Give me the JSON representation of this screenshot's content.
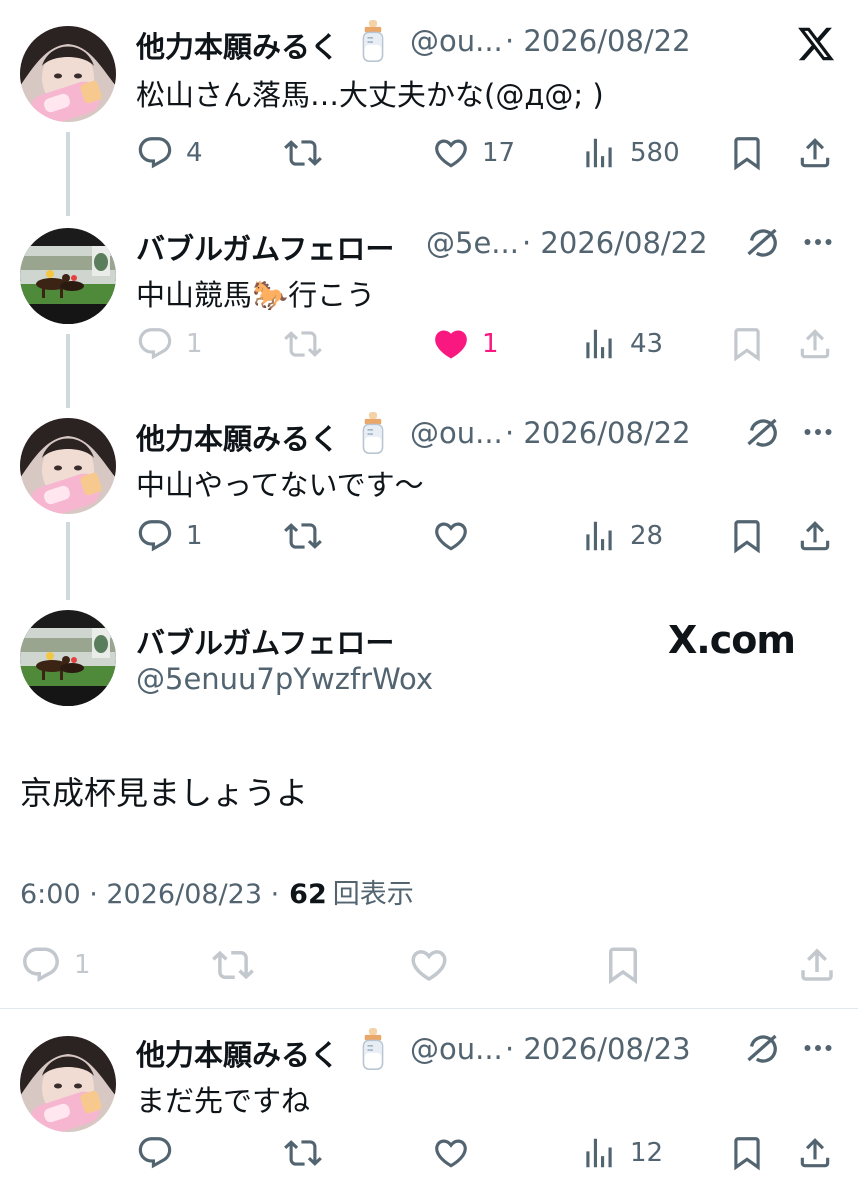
{
  "colors": {
    "text": "#0f1419",
    "muted": "#536471",
    "like_active": "#f91880",
    "line": "#cfd9de"
  },
  "tweets": [
    {
      "name": "他力本願みるく",
      "emoji_icon": "baby-bottle-icon",
      "handle": "@ou...",
      "date": "· 2026/08/22",
      "text": "松山さん落馬…大丈夫かな(@д@; )",
      "replies": "4",
      "retweets": "",
      "likes": "17",
      "views": "580"
    },
    {
      "name": "バブルガムフェロー",
      "handle": "@5e...",
      "date": "· 2026/08/22",
      "text": "中山競馬🐎行こう",
      "replies": "1",
      "retweets": "",
      "likes": "1",
      "views": "43"
    },
    {
      "name": "他力本願みるく",
      "emoji_icon": "baby-bottle-icon",
      "handle": "@ou...",
      "date": "· 2026/08/22",
      "text": "中山やってないです〜",
      "replies": "1",
      "retweets": "",
      "likes": "",
      "views": "28"
    },
    {
      "name": "他力本願みるく",
      "emoji_icon": "baby-bottle-icon",
      "handle": "@ou...",
      "date": "· 2026/08/23",
      "text": "まだ先ですね",
      "replies": "",
      "retweets": "",
      "likes": "",
      "views": "12"
    }
  ],
  "main_tweet": {
    "name": "バブルガムフェロー",
    "handle": "@5enuu7pYwzfrWox",
    "text": "京成杯見ましょうよ",
    "time": "6:00 · 2026/08/23 ·",
    "views_count": "62",
    "views_label": "回表示",
    "replies": "1",
    "brand": "X.com"
  },
  "top_logo": "X"
}
